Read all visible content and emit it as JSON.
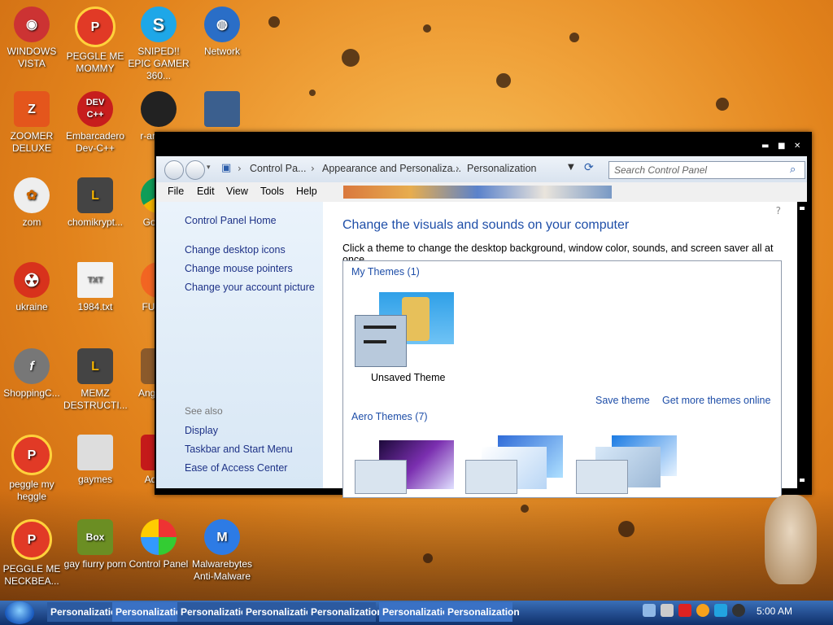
{
  "desktop": {
    "icons": [
      {
        "label": "WINDOWS VISTA",
        "icon": "windows-vista-icon"
      },
      {
        "label": "PEGGLE ME MOMMY",
        "icon": "peggle-icon"
      },
      {
        "label": "SNIPED!! EPIC GAMER 360...",
        "icon": "skype-icon"
      },
      {
        "label": "Network",
        "icon": "network-icon"
      },
      {
        "label": "ZOOMER DELUXE",
        "icon": "zoomer-icon"
      },
      {
        "label": "Embarcadero Dev-C++",
        "icon": "devcpp-icon"
      },
      {
        "label": "r-ant par",
        "icon": "r-ant-icon"
      },
      {
        "label": "",
        "icon": "laptop-icon"
      },
      {
        "label": "zom",
        "icon": "zom-icon"
      },
      {
        "label": "chomikrypt...",
        "icon": "chomikrypt-icon"
      },
      {
        "label": "Go Chr",
        "icon": "chrome-icon"
      },
      {
        "label": "ukraine",
        "icon": "radiation-icon"
      },
      {
        "label": "1984.txt",
        "icon": "text-file-icon"
      },
      {
        "label": "FURRY",
        "icon": "firefox-icon"
      },
      {
        "label": "ShoppingC...",
        "icon": "flash-icon"
      },
      {
        "label": "MEMZ DESTRUCTI...",
        "icon": "memz-icon"
      },
      {
        "label": "Angr Sea",
        "icon": "angry-birds-icon"
      },
      {
        "label": "peggle my heggle",
        "icon": "peggle-icon"
      },
      {
        "label": "gaymes",
        "icon": "folder-icon"
      },
      {
        "label": "Adobe",
        "icon": "adobe-icon"
      },
      {
        "label": "PEGGLE ME NECKBEA...",
        "icon": "peggle-icon"
      },
      {
        "label": "gay fiurry porn",
        "icon": "box-icon"
      },
      {
        "label": "Control Panel",
        "icon": "control-panel-icon"
      },
      {
        "label": "Malwarebytes Anti-Malware",
        "icon": "malwarebytes-icon"
      }
    ]
  },
  "window": {
    "controls": {
      "minimize": "▬",
      "maximize": "■",
      "close": "✕"
    },
    "address": {
      "crumbs": [
        "Control Pa...",
        "Appearance and Personaliza...",
        "Personalization"
      ],
      "search_placeholder": "Search Control Panel"
    },
    "menu": [
      "File",
      "Edit",
      "View",
      "Tools",
      "Help"
    ],
    "left": {
      "home": "Control Panel Home",
      "links": [
        "Change desktop icons",
        "Change mouse pointers",
        "Change your account picture"
      ],
      "see_also_label": "See also",
      "see_also": [
        "Display",
        "Taskbar and Start Menu",
        "Ease of Access Center"
      ]
    },
    "main": {
      "title": "Change the visuals and sounds on your computer",
      "subtitle": "Click a theme to change the desktop background, window color, sounds, and screen saver all at once.",
      "my_themes": "My Themes (1)",
      "unsaved_theme": "Unsaved Theme",
      "save_theme": "Save theme",
      "get_more": "Get more themes online",
      "aero_themes": "Aero Themes (7)"
    }
  },
  "taskbar": {
    "tasks": [
      "Personalization",
      "Personalization",
      "Personalization",
      "Personalization",
      "Personalization",
      "Personalization",
      "Personalization"
    ],
    "clock": "5:00 AM"
  },
  "colors": {
    "link": "#1e3287",
    "heading": "#1e4ea8",
    "taskbar": "#1b3f80"
  }
}
